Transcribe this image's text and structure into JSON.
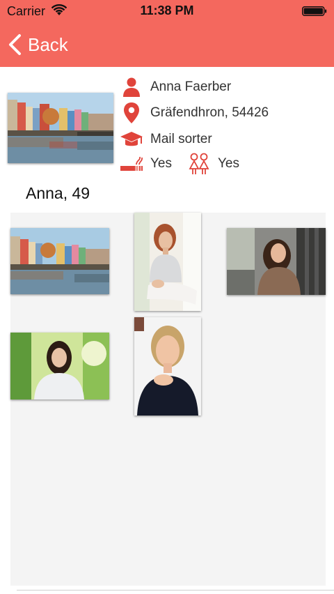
{
  "status_bar": {
    "carrier": "Carrier",
    "time": "11:38 PM"
  },
  "nav": {
    "back_label": "Back"
  },
  "profile": {
    "name": "Anna Faerber",
    "location": "Gräfendhron, 54426",
    "occupation": "Mail sorter",
    "smoker": "Yes",
    "children": "Yes",
    "display_name_age": "Anna, 49"
  },
  "icons": {
    "name": "person-icon",
    "location": "location-pin-icon",
    "occupation": "graduation-cap-icon",
    "smoker": "cigarette-icon",
    "children": "children-icon"
  },
  "colors": {
    "accent": "#f4685e",
    "icon": "#e0443b",
    "gallery_bg": "#f4f4f4"
  }
}
